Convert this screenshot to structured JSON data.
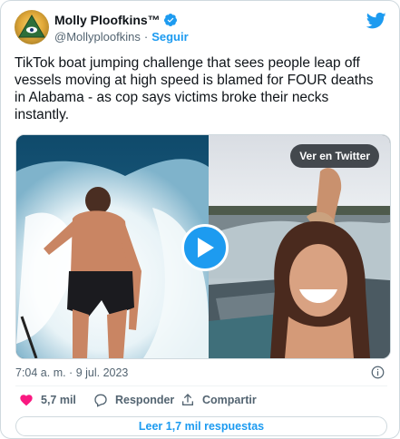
{
  "author": {
    "name": "Molly Ploofkins™",
    "handle": "@Mollyploofkins",
    "separator": "·",
    "follow_label": "Seguir"
  },
  "tweet": {
    "text": "TikTok boat jumping challenge that sees people leap off vessels moving at high speed is blamed for FOUR deaths in Alabama - as cop says victims broke their necks instantly.",
    "timestamp": "7:04 a. m. · 9 jul. 2023"
  },
  "media": {
    "view_on_twitter_label": "Ver en Twitter",
    "play_icon": "play-icon"
  },
  "actions": {
    "likes_count": "5,7 mil",
    "reply_label": "Responder",
    "share_label": "Compartir"
  },
  "replies_button_label": "Leer 1,7 mil respuestas",
  "colors": {
    "accent": "#1d9bf0",
    "like": "#f91880",
    "text_secondary": "#536471",
    "border": "#cfd9de"
  }
}
